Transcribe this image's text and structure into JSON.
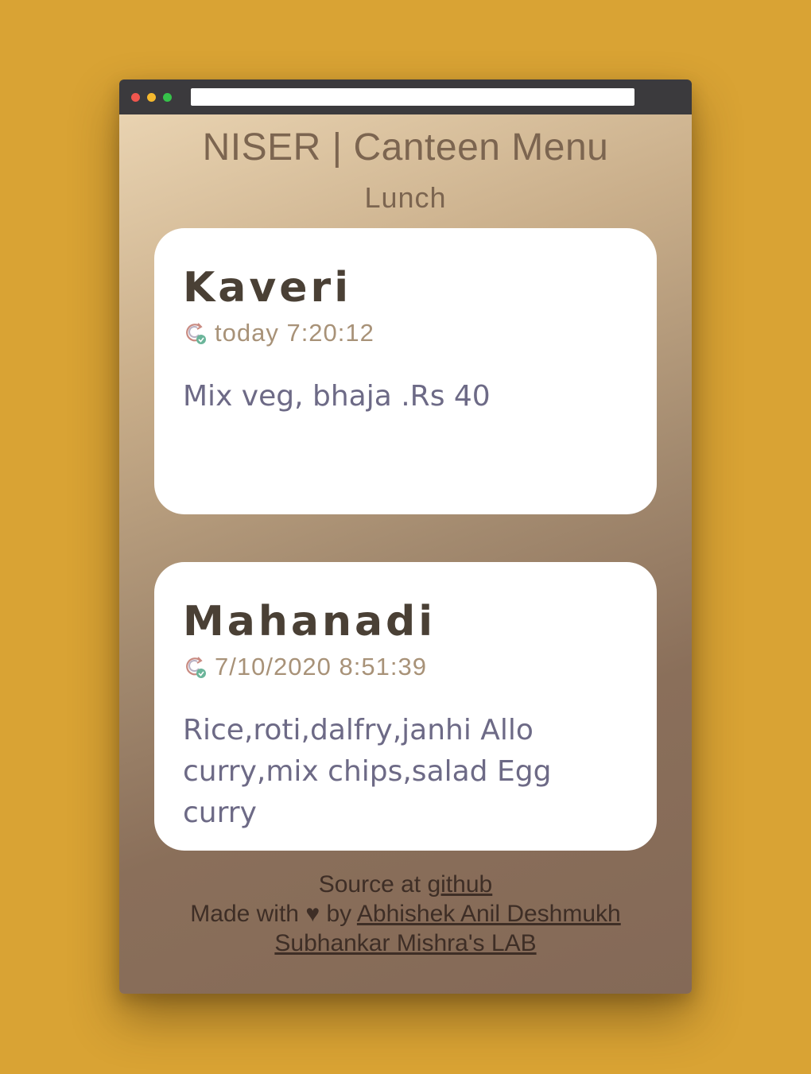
{
  "header": {
    "title": "NISER | Canteen Menu",
    "meal": "Lunch"
  },
  "cards": [
    {
      "name": "Kaveri",
      "updated": "today 7:20:12",
      "icon": "sync-check-icon",
      "items": "Mix veg, bhaja .Rs 40"
    },
    {
      "name": "Mahanadi",
      "updated": "7/10/2020 8:51:39",
      "icon": "sync-check-icon",
      "items": "Rice,roti,dalfry,janhi Allo curry,mix chips,salad Egg curry"
    }
  ],
  "footer": {
    "source_prefix": "Source at",
    "source_link": "github",
    "made_with": "Made with",
    "heart": "♥",
    "by": "by",
    "author_link": "Abhishek Anil Deshmukh",
    "lab_link": "Subhankar Mishra's LAB"
  },
  "colors": {
    "background": "#d9a334",
    "title": "#7c6550",
    "card_name": "#4a4035",
    "timestamp": "#a89278",
    "items": "#6d6a86"
  }
}
